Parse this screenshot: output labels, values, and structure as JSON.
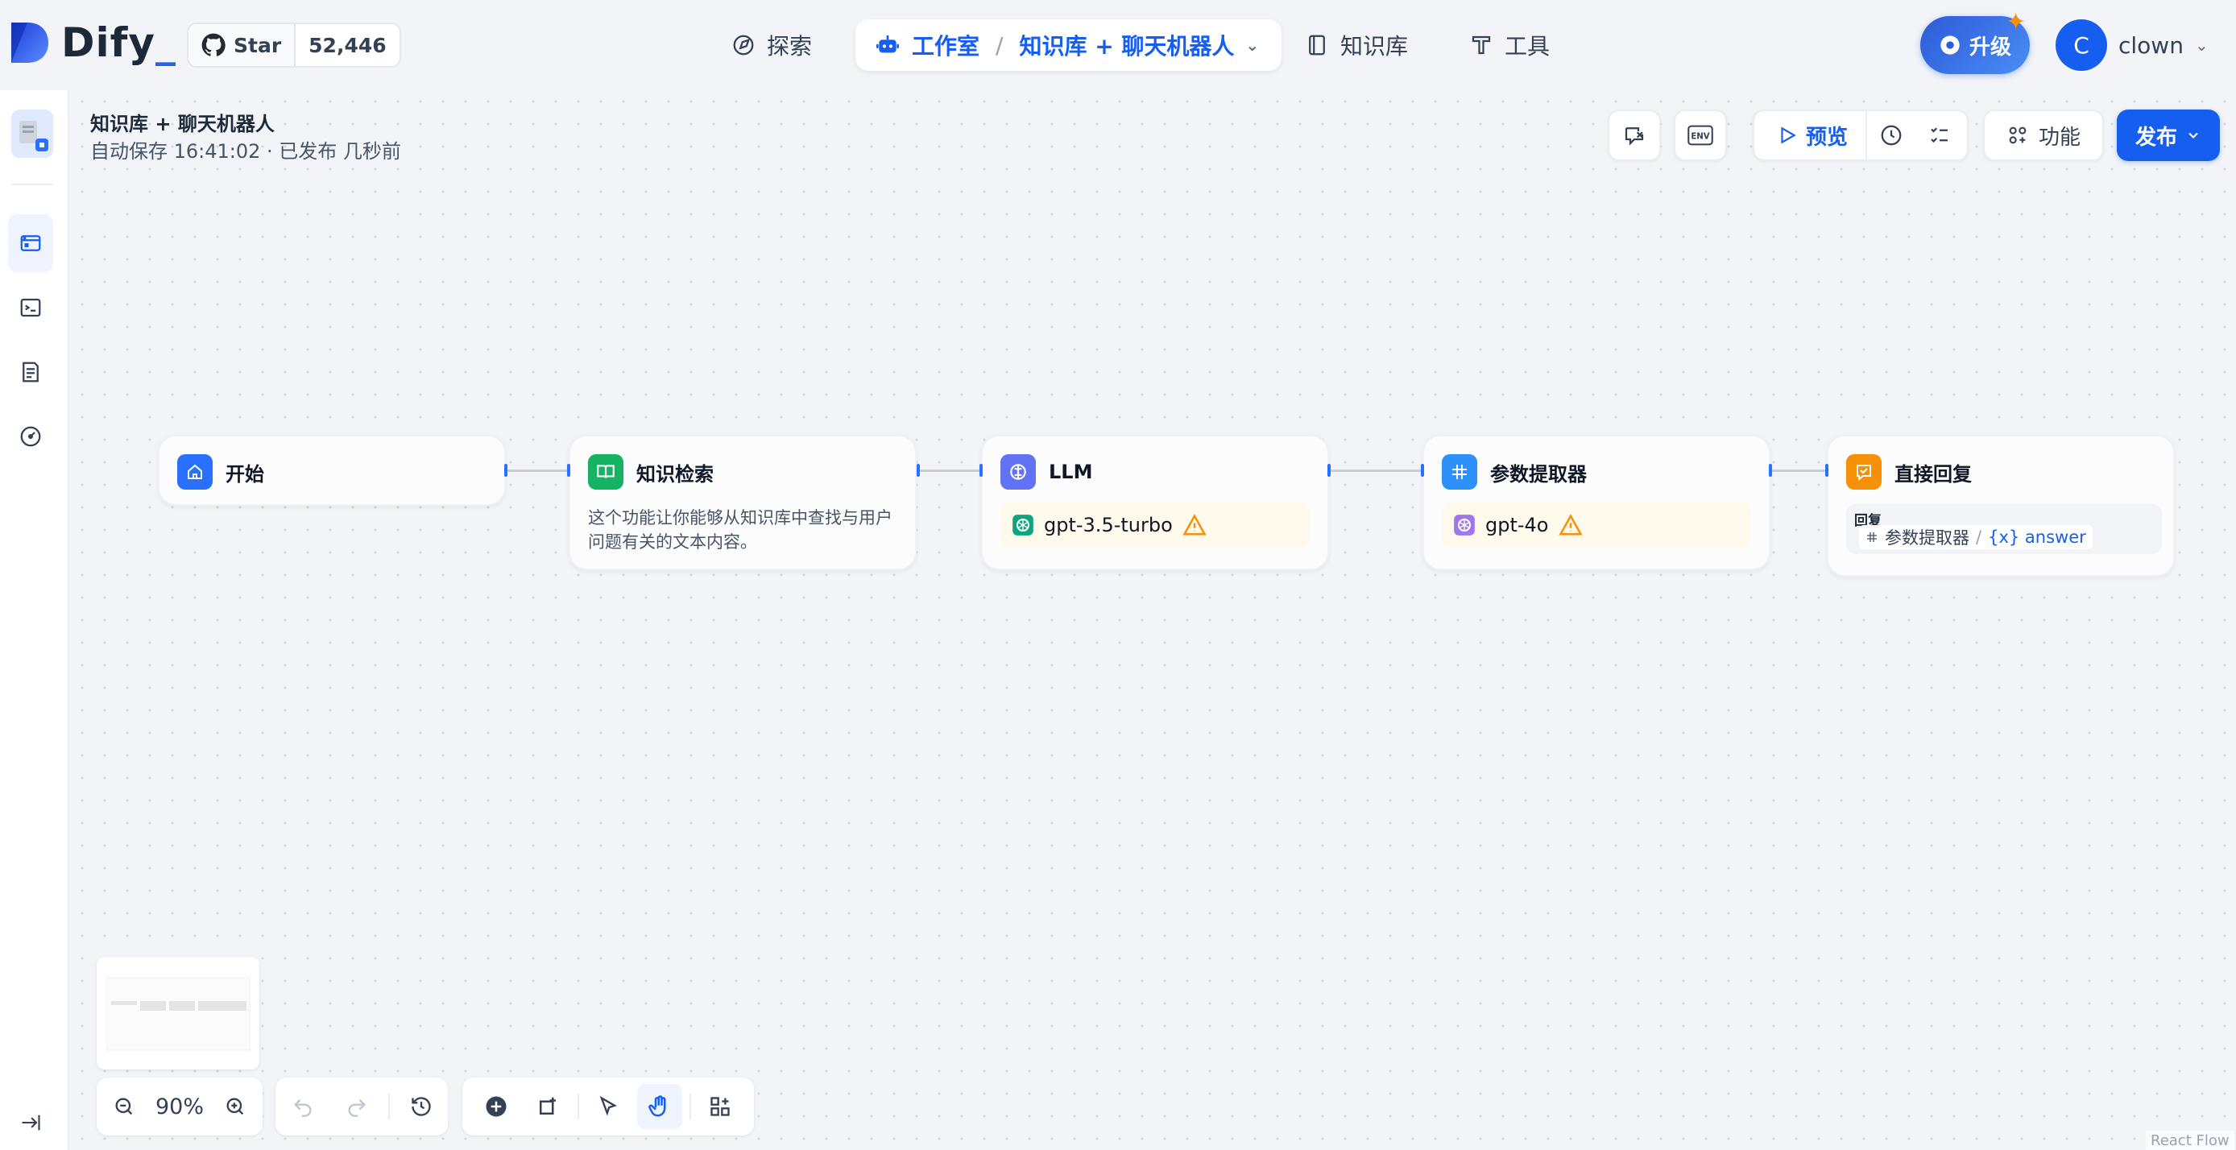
{
  "brand": {
    "name": "Dify",
    "cursor": "_"
  },
  "github": {
    "star_label": "Star",
    "star_count": "52,446"
  },
  "nav": {
    "explore": "探索",
    "studio": "工作室",
    "separator": "/",
    "current_app": "知识库 + 聊天机器人",
    "knowledge": "知识库",
    "tools": "工具"
  },
  "upgrade": {
    "label": "升级"
  },
  "user": {
    "initial": "C",
    "name": "clown"
  },
  "app": {
    "title": "知识库 + 聊天机器人",
    "status": "自动保存 16:41:02 · 已发布 几秒前"
  },
  "toolbar": {
    "env_label": "ENV",
    "preview_label": "预览",
    "features_label": "功能",
    "publish_label": "发布"
  },
  "nodes": {
    "start": {
      "title": "开始"
    },
    "retrieval": {
      "title": "知识检索",
      "description": "这个功能让你能够从知识库中查找与用户问题有关的文本内容。"
    },
    "llm": {
      "title": "LLM",
      "model": "gpt-3.5-turbo"
    },
    "extractor": {
      "title": "参数提取器",
      "model": "gpt-4o"
    },
    "answer": {
      "title": "直接回复",
      "reply_label": "回复",
      "var_node": "参数提取器",
      "var_separator": "/",
      "var_name": "{x} answer"
    }
  },
  "zoom": {
    "level": "90%"
  },
  "attribution": "React Flow",
  "colors": {
    "accent": "#155eef",
    "start_icon": "#2970ff",
    "retrieval_icon": "#16b364",
    "llm_icon": "#6172f3",
    "extractor_icon": "#2e90fa",
    "answer_icon": "#f79009",
    "warning": "#f79009"
  }
}
